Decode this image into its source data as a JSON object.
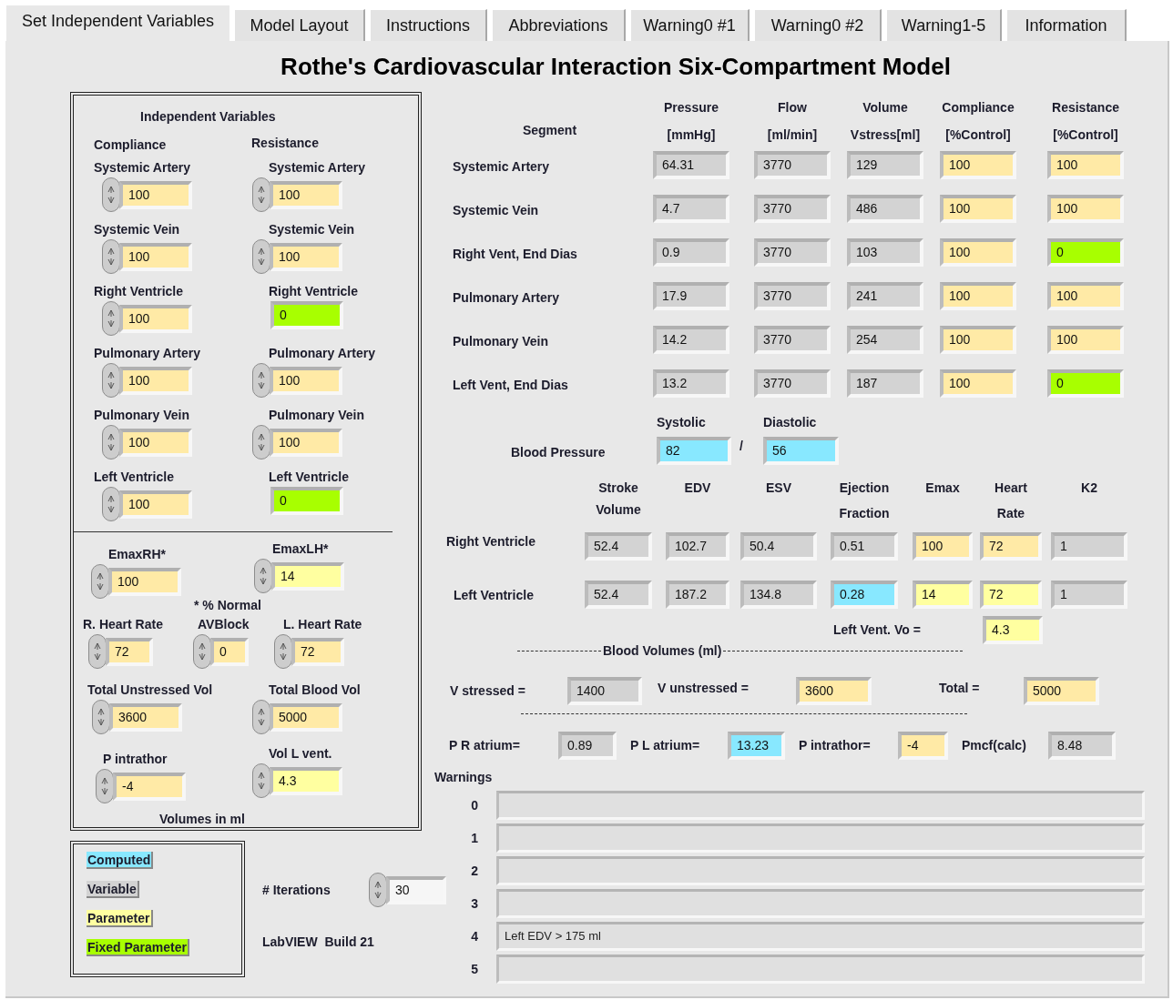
{
  "tabs": [
    {
      "label": "Set Independent Variables",
      "selected": true
    },
    {
      "label": "Model Layout",
      "selected": false
    },
    {
      "label": "Instructions",
      "selected": false
    },
    {
      "label": "Abbreviations",
      "selected": false
    },
    {
      "label": "Warning0 #1",
      "selected": false
    },
    {
      "label": "Warning0 #2",
      "selected": false
    },
    {
      "label": "Warning1-5",
      "selected": false
    },
    {
      "label": "Information",
      "selected": false
    }
  ],
  "title": "Rothe's Cardiovascular Interaction Six-Compartment Model",
  "independent_variables": {
    "heading": "Independent Variables",
    "compliance_heading": "Compliance",
    "resistance_heading": "Resistance",
    "compliance": [
      {
        "label": "Systemic Artery",
        "value": "100",
        "kind": "parameter"
      },
      {
        "label": "Systemic Vein",
        "value": "100",
        "kind": "parameter"
      },
      {
        "label": "Right Ventricle",
        "value": "100",
        "kind": "parameter"
      },
      {
        "label": "Pulmonary Artery",
        "value": "100",
        "kind": "parameter"
      },
      {
        "label": "Pulmonary Vein",
        "value": "100",
        "kind": "parameter"
      },
      {
        "label": "Left Ventricle",
        "value": "100",
        "kind": "parameter"
      }
    ],
    "resistance": [
      {
        "label": "Systemic Artery",
        "value": "100",
        "kind": "parameter"
      },
      {
        "label": "Systemic Vein",
        "value": "100",
        "kind": "parameter"
      },
      {
        "label": "Right Ventricle",
        "value": "0",
        "kind": "fixed"
      },
      {
        "label": "Pulmonary Artery",
        "value": "100",
        "kind": "parameter"
      },
      {
        "label": "Pulmonary Vein",
        "value": "100",
        "kind": "parameter"
      },
      {
        "label": "Left Ventricle",
        "value": "0",
        "kind": "fixed"
      }
    ],
    "emax": [
      {
        "label": "EmaxRH*",
        "value": "100",
        "kind": "parameter"
      },
      {
        "label": "EmaxLH*",
        "value": "14",
        "kind": "bright"
      }
    ],
    "emax_note": "* % Normal",
    "rates": [
      {
        "label": "R. Heart Rate",
        "value": "72",
        "kind": "parameter"
      },
      {
        "label": "AVBlock",
        "value": "0",
        "kind": "parameter"
      },
      {
        "label": "L. Heart Rate",
        "value": "72",
        "kind": "parameter"
      }
    ],
    "volumes": [
      {
        "label": "Total Unstressed Vol",
        "value": "3600",
        "kind": "parameter"
      },
      {
        "label": "Total Blood Vol",
        "value": "5000",
        "kind": "parameter"
      },
      {
        "label": "P intrathor",
        "value": "-4",
        "kind": "parameter"
      },
      {
        "label": "Vol L vent.",
        "value": "4.3",
        "kind": "bright"
      }
    ],
    "volumes_note": "Volumes in ml"
  },
  "legend": [
    {
      "label": "Computed",
      "kind": "computed"
    },
    {
      "label": "Variable",
      "kind": "variable"
    },
    {
      "label": "Parameter",
      "kind": "bright"
    },
    {
      "label": "Fixed Parameter",
      "kind": "fixed"
    }
  ],
  "iterations": {
    "label": "# Iterations",
    "value": "30",
    "kind": "plain"
  },
  "build": "LabVIEW  Build 21",
  "segments": {
    "label_heading": "Segment",
    "columns": [
      {
        "title": "Pressure",
        "unit": "[mmHg]"
      },
      {
        "title": "Flow",
        "unit": "[ml/min]"
      },
      {
        "title": "Volume",
        "unit": "Vstress[ml]"
      },
      {
        "title": "Compliance",
        "unit": "[%Control]"
      },
      {
        "title": "Resistance",
        "unit": "[%Control]"
      }
    ],
    "rows": [
      {
        "label": "Systemic Artery",
        "cells": [
          {
            "value": "64.31",
            "kind": "variable"
          },
          {
            "value": "3770",
            "kind": "variable"
          },
          {
            "value": "129",
            "kind": "variable"
          },
          {
            "value": "100",
            "kind": "parameter"
          },
          {
            "value": "100",
            "kind": "parameter"
          }
        ]
      },
      {
        "label": "Systemic Vein",
        "cells": [
          {
            "value": "4.7",
            "kind": "variable"
          },
          {
            "value": "3770",
            "kind": "variable"
          },
          {
            "value": "486",
            "kind": "variable"
          },
          {
            "value": "100",
            "kind": "parameter"
          },
          {
            "value": "100",
            "kind": "parameter"
          }
        ]
      },
      {
        "label": "Right Vent, End Dias",
        "cells": [
          {
            "value": "0.9",
            "kind": "variable"
          },
          {
            "value": "3770",
            "kind": "variable"
          },
          {
            "value": "103",
            "kind": "variable"
          },
          {
            "value": "100",
            "kind": "parameter"
          },
          {
            "value": "0",
            "kind": "fixed"
          }
        ]
      },
      {
        "label": "Pulmonary Artery",
        "cells": [
          {
            "value": "17.9",
            "kind": "variable"
          },
          {
            "value": "3770",
            "kind": "variable"
          },
          {
            "value": "241",
            "kind": "variable"
          },
          {
            "value": "100",
            "kind": "parameter"
          },
          {
            "value": "100",
            "kind": "parameter"
          }
        ]
      },
      {
        "label": "Pulmonary Vein",
        "cells": [
          {
            "value": "14.2",
            "kind": "variable"
          },
          {
            "value": "3770",
            "kind": "variable"
          },
          {
            "value": "254",
            "kind": "variable"
          },
          {
            "value": "100",
            "kind": "parameter"
          },
          {
            "value": "100",
            "kind": "parameter"
          }
        ]
      },
      {
        "label": "Left Vent, End Dias",
        "cells": [
          {
            "value": "13.2",
            "kind": "variable"
          },
          {
            "value": "3770",
            "kind": "variable"
          },
          {
            "value": "187",
            "kind": "variable"
          },
          {
            "value": "100",
            "kind": "parameter"
          },
          {
            "value": "0",
            "kind": "fixed"
          }
        ]
      }
    ]
  },
  "blood_pressure": {
    "label": "Blood Pressure",
    "separator": "/",
    "systolic": {
      "label": "Systolic",
      "value": "82",
      "kind": "computed"
    },
    "diastolic": {
      "label": "Diastolic",
      "value": "56",
      "kind": "computed"
    }
  },
  "ventricles": {
    "columns": [
      {
        "lines": [
          "Stroke",
          "Volume"
        ]
      },
      {
        "lines": [
          "EDV"
        ]
      },
      {
        "lines": [
          "ESV"
        ]
      },
      {
        "lines": [
          "Ejection",
          "Fraction"
        ]
      },
      {
        "lines": [
          "Emax"
        ]
      },
      {
        "lines": [
          "Heart",
          "Rate"
        ]
      },
      {
        "lines": [
          "K2"
        ]
      }
    ],
    "rows": [
      {
        "label": "Right Ventricle",
        "cells": [
          {
            "value": "52.4",
            "kind": "variable"
          },
          {
            "value": "102.7",
            "kind": "variable"
          },
          {
            "value": "50.4",
            "kind": "variable"
          },
          {
            "value": "0.51",
            "kind": "variable"
          },
          {
            "value": "100",
            "kind": "parameter"
          },
          {
            "value": "72",
            "kind": "parameter"
          },
          {
            "value": "1",
            "kind": "variable"
          }
        ]
      },
      {
        "label": "Left Ventricle",
        "cells": [
          {
            "value": "52.4",
            "kind": "variable"
          },
          {
            "value": "187.2",
            "kind": "variable"
          },
          {
            "value": "134.8",
            "kind": "variable"
          },
          {
            "value": "0.28",
            "kind": "computed"
          },
          {
            "value": "14",
            "kind": "bright"
          },
          {
            "value": "72",
            "kind": "bright"
          },
          {
            "value": "1",
            "kind": "variable"
          }
        ]
      }
    ]
  },
  "left_vent_vo": {
    "label": "Left Vent. Vo =",
    "value": "4.3",
    "kind": "bright"
  },
  "blood_volumes": {
    "title": "Blood Volumes (ml)",
    "items": [
      {
        "label": "V stressed =",
        "value": "1400",
        "kind": "variable"
      },
      {
        "label": "V unstressed =",
        "value": "3600",
        "kind": "parameter"
      },
      {
        "label": "Total =",
        "value": "5000",
        "kind": "parameter"
      }
    ]
  },
  "pressures": [
    {
      "label": "P R atrium=",
      "value": "0.89",
      "kind": "variable"
    },
    {
      "label": "P L atrium=",
      "value": "13.23",
      "kind": "computed"
    },
    {
      "label": "P intrathor=",
      "value": "-4",
      "kind": "parameter"
    },
    {
      "label": "Pmcf(calc)",
      "value": "8.48",
      "kind": "variable"
    }
  ],
  "warnings": {
    "title": "Warnings",
    "rows": [
      {
        "index": "0"
      },
      {
        "index": "1"
      },
      {
        "index": "2"
      },
      {
        "index": "3"
      },
      {
        "index": "4",
        "text": "Left EDV > 175 ml"
      },
      {
        "index": "5"
      }
    ]
  }
}
